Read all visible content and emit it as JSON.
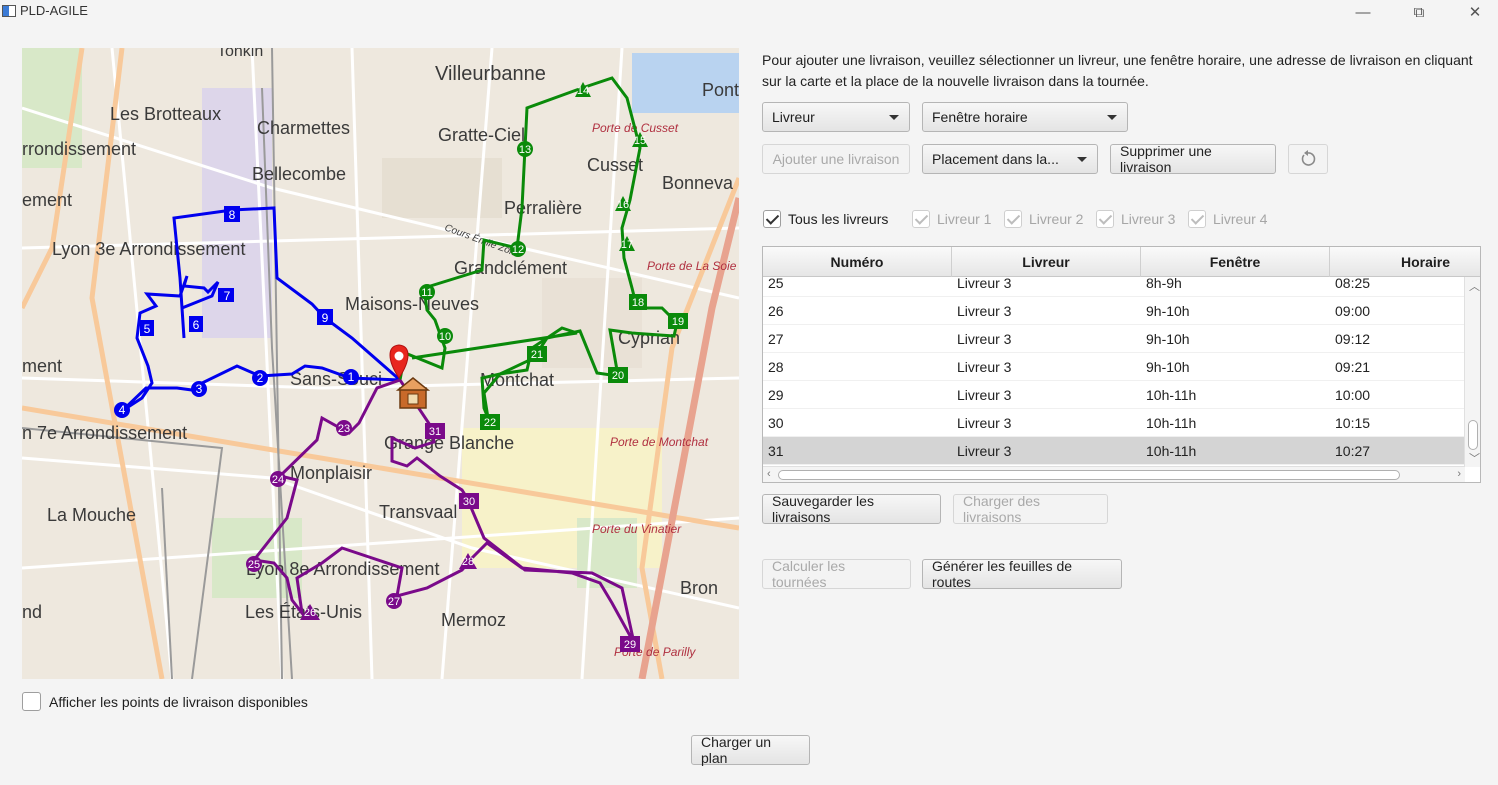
{
  "window": {
    "title": "PLD-AGILE",
    "minimize": "—",
    "maximize": "⧉",
    "close": "✕"
  },
  "map": {
    "labels": [
      "Villeurbanne",
      "Les Brotteaux",
      "Charmettes",
      "Gratte-Ciel",
      "rrondissement",
      "Bellecombe",
      "Cusset",
      "Bonneva",
      "Perralière",
      "Lyon 3e Arrondissement",
      "Grandclément",
      "Maisons-Neuves",
      "Cyprian",
      "Montchat",
      "Sans-Souci",
      "n 7e Arrondissement",
      "Grange Blanche",
      "Monplaisir",
      "La Mouche",
      "Transvaal",
      "Lyon 8e Arrondissement",
      "Bron",
      "Les États-Unis",
      "Mermoz",
      "Porte de Cusset",
      "Porte de La Soie",
      "Porte de Montchat",
      "Porte du Vinatier",
      "Porte de Parilly",
      "Pont",
      "ement",
      "ment",
      "nd",
      "Tonkin",
      "Cours Émile Zola"
    ],
    "route_colors": {
      "livreur_1": "#0000ee",
      "livreur_2": "#0a8a0a",
      "livreur_3": "#7a0a8a"
    },
    "markers": {
      "blue": [
        "1",
        "2",
        "3",
        "4",
        "5",
        "6",
        "7",
        "8",
        "9"
      ],
      "green": [
        "10",
        "11",
        "12",
        "13",
        "14",
        "15",
        "16",
        "17",
        "18",
        "19",
        "20",
        "21",
        "22"
      ],
      "purple": [
        "23",
        "24",
        "25",
        "26",
        "27",
        "28",
        "29",
        "30",
        "31"
      ]
    },
    "warehouse_icon": "warehouse-icon",
    "pin_icon": "location-pin-icon"
  },
  "instructions": "Pour ajouter une livraison, veuillez sélectionner un livreur, une fenêtre horaire, une adresse de livraison en cliquant sur la carte et la place de la nouvelle livraison dans la tournée.",
  "controls": {
    "livreur_combo": "Livreur",
    "fenetre_combo": "Fenêtre horaire",
    "add_button": "Ajouter une livraison",
    "placement_combo": "Placement dans la...",
    "delete_button": "Supprimer une livraison",
    "undo_icon": "undo-icon"
  },
  "filters": [
    {
      "label": "Tous les livreurs",
      "checked": true,
      "enabled": true
    },
    {
      "label": "Livreur 1",
      "checked": true,
      "enabled": false
    },
    {
      "label": "Livreur 2",
      "checked": true,
      "enabled": false
    },
    {
      "label": "Livreur 3",
      "checked": true,
      "enabled": false
    },
    {
      "label": "Livreur 4",
      "checked": true,
      "enabled": false
    }
  ],
  "table": {
    "headers": [
      "Numéro",
      "Livreur",
      "Fenêtre",
      "Horaire"
    ],
    "rows": [
      [
        "25",
        "Livreur 3",
        "8h-9h",
        "08:25"
      ],
      [
        "26",
        "Livreur 3",
        "9h-10h",
        "09:00"
      ],
      [
        "27",
        "Livreur 3",
        "9h-10h",
        "09:12"
      ],
      [
        "28",
        "Livreur 3",
        "9h-10h",
        "09:21"
      ],
      [
        "29",
        "Livreur 3",
        "10h-11h",
        "10:00"
      ],
      [
        "30",
        "Livreur 3",
        "10h-11h",
        "10:15"
      ],
      [
        "31",
        "Livreur 3",
        "10h-11h",
        "10:27"
      ]
    ],
    "selected_row": 6
  },
  "buttons": {
    "save": "Sauvegarder les livraisons",
    "load": "Charger des livraisons",
    "compute": "Calculer les tournées",
    "generate": "Générer les feuilles de routes",
    "load_plan": "Charger un plan"
  },
  "show_points_label": "Afficher les points de livraison disponibles"
}
